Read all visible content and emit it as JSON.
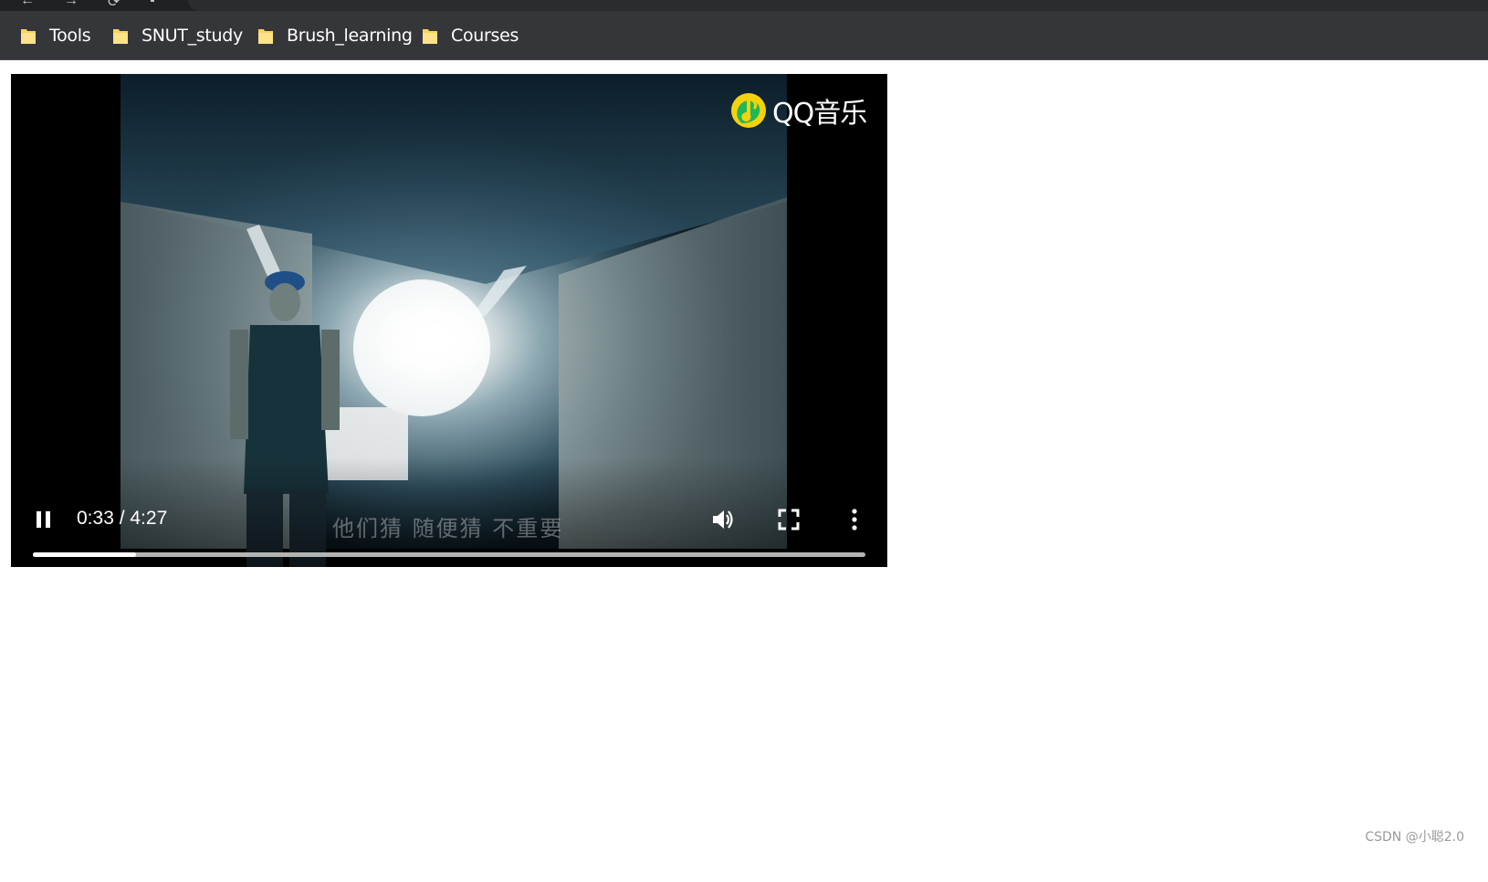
{
  "bookmarks_bar": {
    "items": [
      {
        "label": "Tools",
        "icon": "folder-icon"
      },
      {
        "label": "SNUT_study",
        "icon": "folder-icon"
      },
      {
        "label": "Brush_learning",
        "icon": "folder-icon"
      },
      {
        "label": "Courses",
        "icon": "folder-icon"
      }
    ],
    "folder_color": "#f9d45c"
  },
  "video": {
    "logo_text": "QQ音乐",
    "subtitle": "他们猜 随便猜 不重要",
    "time_display": "0:33 / 4:27",
    "current_time": "0:33",
    "duration": "4:27",
    "progress_fraction": 0.1236,
    "controls": {
      "play_state": "playing",
      "pause_icon": "pause-icon",
      "volume_icon": "volume-icon",
      "fullscreen_icon": "fullscreen-icon",
      "more_icon": "more-vertical-icon"
    },
    "logo_colors": {
      "circle": "#f5d20d",
      "note": "#1fb859"
    }
  },
  "watermark": "CSDN @小聪2.0"
}
